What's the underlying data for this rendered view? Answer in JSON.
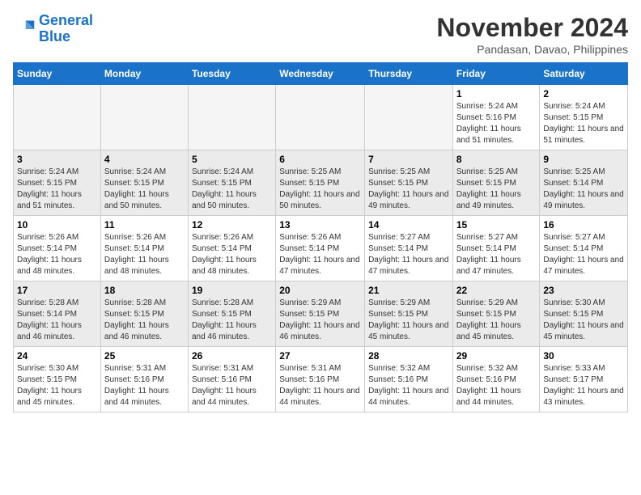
{
  "header": {
    "logo_line1": "General",
    "logo_line2": "Blue",
    "month_title": "November 2024",
    "location": "Pandasan, Davao, Philippines"
  },
  "calendar": {
    "days_of_week": [
      "Sunday",
      "Monday",
      "Tuesday",
      "Wednesday",
      "Thursday",
      "Friday",
      "Saturday"
    ],
    "weeks": [
      [
        {
          "day": "",
          "info": ""
        },
        {
          "day": "",
          "info": ""
        },
        {
          "day": "",
          "info": ""
        },
        {
          "day": "",
          "info": ""
        },
        {
          "day": "",
          "info": ""
        },
        {
          "day": "1",
          "info": "Sunrise: 5:24 AM\nSunset: 5:16 PM\nDaylight: 11 hours and 51 minutes."
        },
        {
          "day": "2",
          "info": "Sunrise: 5:24 AM\nSunset: 5:15 PM\nDaylight: 11 hours and 51 minutes."
        }
      ],
      [
        {
          "day": "3",
          "info": "Sunrise: 5:24 AM\nSunset: 5:15 PM\nDaylight: 11 hours and 51 minutes."
        },
        {
          "day": "4",
          "info": "Sunrise: 5:24 AM\nSunset: 5:15 PM\nDaylight: 11 hours and 50 minutes."
        },
        {
          "day": "5",
          "info": "Sunrise: 5:24 AM\nSunset: 5:15 PM\nDaylight: 11 hours and 50 minutes."
        },
        {
          "day": "6",
          "info": "Sunrise: 5:25 AM\nSunset: 5:15 PM\nDaylight: 11 hours and 50 minutes."
        },
        {
          "day": "7",
          "info": "Sunrise: 5:25 AM\nSunset: 5:15 PM\nDaylight: 11 hours and 49 minutes."
        },
        {
          "day": "8",
          "info": "Sunrise: 5:25 AM\nSunset: 5:15 PM\nDaylight: 11 hours and 49 minutes."
        },
        {
          "day": "9",
          "info": "Sunrise: 5:25 AM\nSunset: 5:14 PM\nDaylight: 11 hours and 49 minutes."
        }
      ],
      [
        {
          "day": "10",
          "info": "Sunrise: 5:26 AM\nSunset: 5:14 PM\nDaylight: 11 hours and 48 minutes."
        },
        {
          "day": "11",
          "info": "Sunrise: 5:26 AM\nSunset: 5:14 PM\nDaylight: 11 hours and 48 minutes."
        },
        {
          "day": "12",
          "info": "Sunrise: 5:26 AM\nSunset: 5:14 PM\nDaylight: 11 hours and 48 minutes."
        },
        {
          "day": "13",
          "info": "Sunrise: 5:26 AM\nSunset: 5:14 PM\nDaylight: 11 hours and 47 minutes."
        },
        {
          "day": "14",
          "info": "Sunrise: 5:27 AM\nSunset: 5:14 PM\nDaylight: 11 hours and 47 minutes."
        },
        {
          "day": "15",
          "info": "Sunrise: 5:27 AM\nSunset: 5:14 PM\nDaylight: 11 hours and 47 minutes."
        },
        {
          "day": "16",
          "info": "Sunrise: 5:27 AM\nSunset: 5:14 PM\nDaylight: 11 hours and 47 minutes."
        }
      ],
      [
        {
          "day": "17",
          "info": "Sunrise: 5:28 AM\nSunset: 5:14 PM\nDaylight: 11 hours and 46 minutes."
        },
        {
          "day": "18",
          "info": "Sunrise: 5:28 AM\nSunset: 5:15 PM\nDaylight: 11 hours and 46 minutes."
        },
        {
          "day": "19",
          "info": "Sunrise: 5:28 AM\nSunset: 5:15 PM\nDaylight: 11 hours and 46 minutes."
        },
        {
          "day": "20",
          "info": "Sunrise: 5:29 AM\nSunset: 5:15 PM\nDaylight: 11 hours and 46 minutes."
        },
        {
          "day": "21",
          "info": "Sunrise: 5:29 AM\nSunset: 5:15 PM\nDaylight: 11 hours and 45 minutes."
        },
        {
          "day": "22",
          "info": "Sunrise: 5:29 AM\nSunset: 5:15 PM\nDaylight: 11 hours and 45 minutes."
        },
        {
          "day": "23",
          "info": "Sunrise: 5:30 AM\nSunset: 5:15 PM\nDaylight: 11 hours and 45 minutes."
        }
      ],
      [
        {
          "day": "24",
          "info": "Sunrise: 5:30 AM\nSunset: 5:15 PM\nDaylight: 11 hours and 45 minutes."
        },
        {
          "day": "25",
          "info": "Sunrise: 5:31 AM\nSunset: 5:16 PM\nDaylight: 11 hours and 44 minutes."
        },
        {
          "day": "26",
          "info": "Sunrise: 5:31 AM\nSunset: 5:16 PM\nDaylight: 11 hours and 44 minutes."
        },
        {
          "day": "27",
          "info": "Sunrise: 5:31 AM\nSunset: 5:16 PM\nDaylight: 11 hours and 44 minutes."
        },
        {
          "day": "28",
          "info": "Sunrise: 5:32 AM\nSunset: 5:16 PM\nDaylight: 11 hours and 44 minutes."
        },
        {
          "day": "29",
          "info": "Sunrise: 5:32 AM\nSunset: 5:16 PM\nDaylight: 11 hours and 44 minutes."
        },
        {
          "day": "30",
          "info": "Sunrise: 5:33 AM\nSunset: 5:17 PM\nDaylight: 11 hours and 43 minutes."
        }
      ]
    ]
  }
}
